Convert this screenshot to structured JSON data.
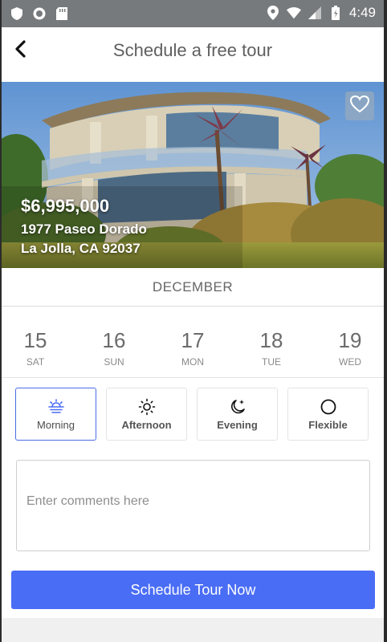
{
  "status_bar": {
    "time": "4:49",
    "left_icons": [
      "shield-icon",
      "circle-record-icon",
      "sd-card-icon"
    ],
    "right_icons": [
      "location-icon",
      "wifi-icon",
      "signal-icon",
      "battery-icon"
    ]
  },
  "header": {
    "title": "Schedule a free tour",
    "back_icon": "chevron-left-icon"
  },
  "listing": {
    "price": "$6,995,000",
    "address_line1": "1977 Paseo Dorado",
    "address_line2": "La Jolla, CA 92037",
    "favorite_icon": "heart-outline-icon"
  },
  "calendar": {
    "month": "DECEMBER",
    "days": [
      {
        "num": "15",
        "dow": "SAT"
      },
      {
        "num": "16",
        "dow": "SUN"
      },
      {
        "num": "17",
        "dow": "MON"
      },
      {
        "num": "18",
        "dow": "TUE"
      },
      {
        "num": "19",
        "dow": "WED"
      }
    ]
  },
  "times": [
    {
      "label": "Morning",
      "icon": "sunrise-icon",
      "selected": true
    },
    {
      "label": "Afternoon",
      "icon": "sun-icon",
      "selected": false
    },
    {
      "label": "Evening",
      "icon": "moon-star-icon",
      "selected": false
    },
    {
      "label": "Flexible",
      "icon": "circle-icon",
      "selected": false
    }
  ],
  "comments": {
    "placeholder": "Enter comments here",
    "value": ""
  },
  "cta": {
    "label": "Schedule Tour Now"
  },
  "colors": {
    "accent": "#4a6df5",
    "status_bar": "#777a7c",
    "selected_border": "#4a6de5"
  }
}
